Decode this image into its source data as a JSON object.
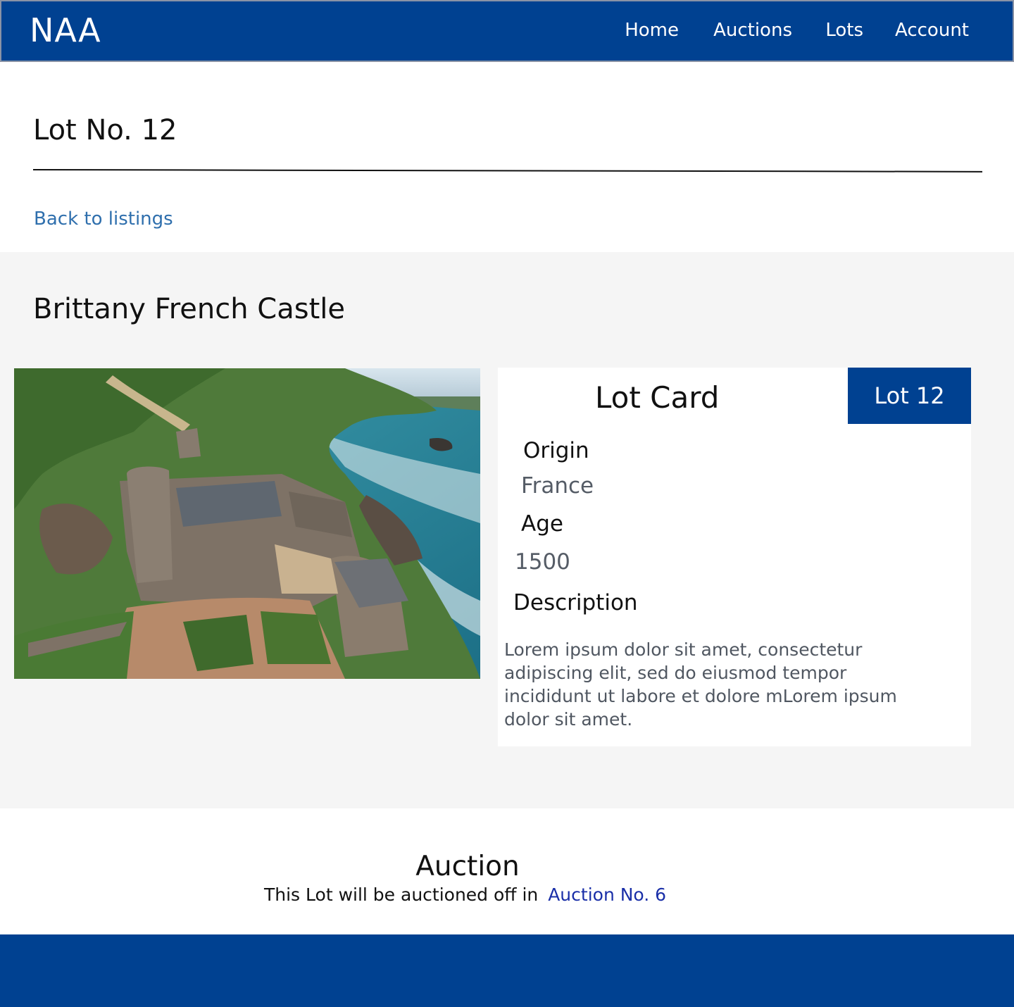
{
  "header": {
    "brand": "NAA",
    "nav": [
      "Home",
      "Auctions",
      "Lots",
      "Account"
    ]
  },
  "page": {
    "title": "Lot No. 12",
    "back_link": "Back to listings"
  },
  "lot": {
    "name": "Brittany French Castle",
    "image_alt": "Aerial view of a stone castle on a rocky coastal headland",
    "card": {
      "title": "Lot Card",
      "badge": "Lot 12",
      "origin_label": "Origin",
      "origin_value": "France",
      "age_label": "Age",
      "age_value": "1500",
      "description_label": "Description",
      "description_text": "Lorem ipsum dolor sit amet, consectetur adipiscing elit, sed do eiusmod tempor incididunt ut labore et dolore mLorem ipsum dolor sit amet."
    }
  },
  "auction": {
    "heading": "Auction",
    "text": "This Lot will be auctioned off in",
    "link": "Auction No. 6"
  },
  "colors": {
    "primary": "#004191",
    "link": "#2f6fad",
    "auction_link": "#1a2fa8",
    "section_bg": "#f5f5f5"
  }
}
